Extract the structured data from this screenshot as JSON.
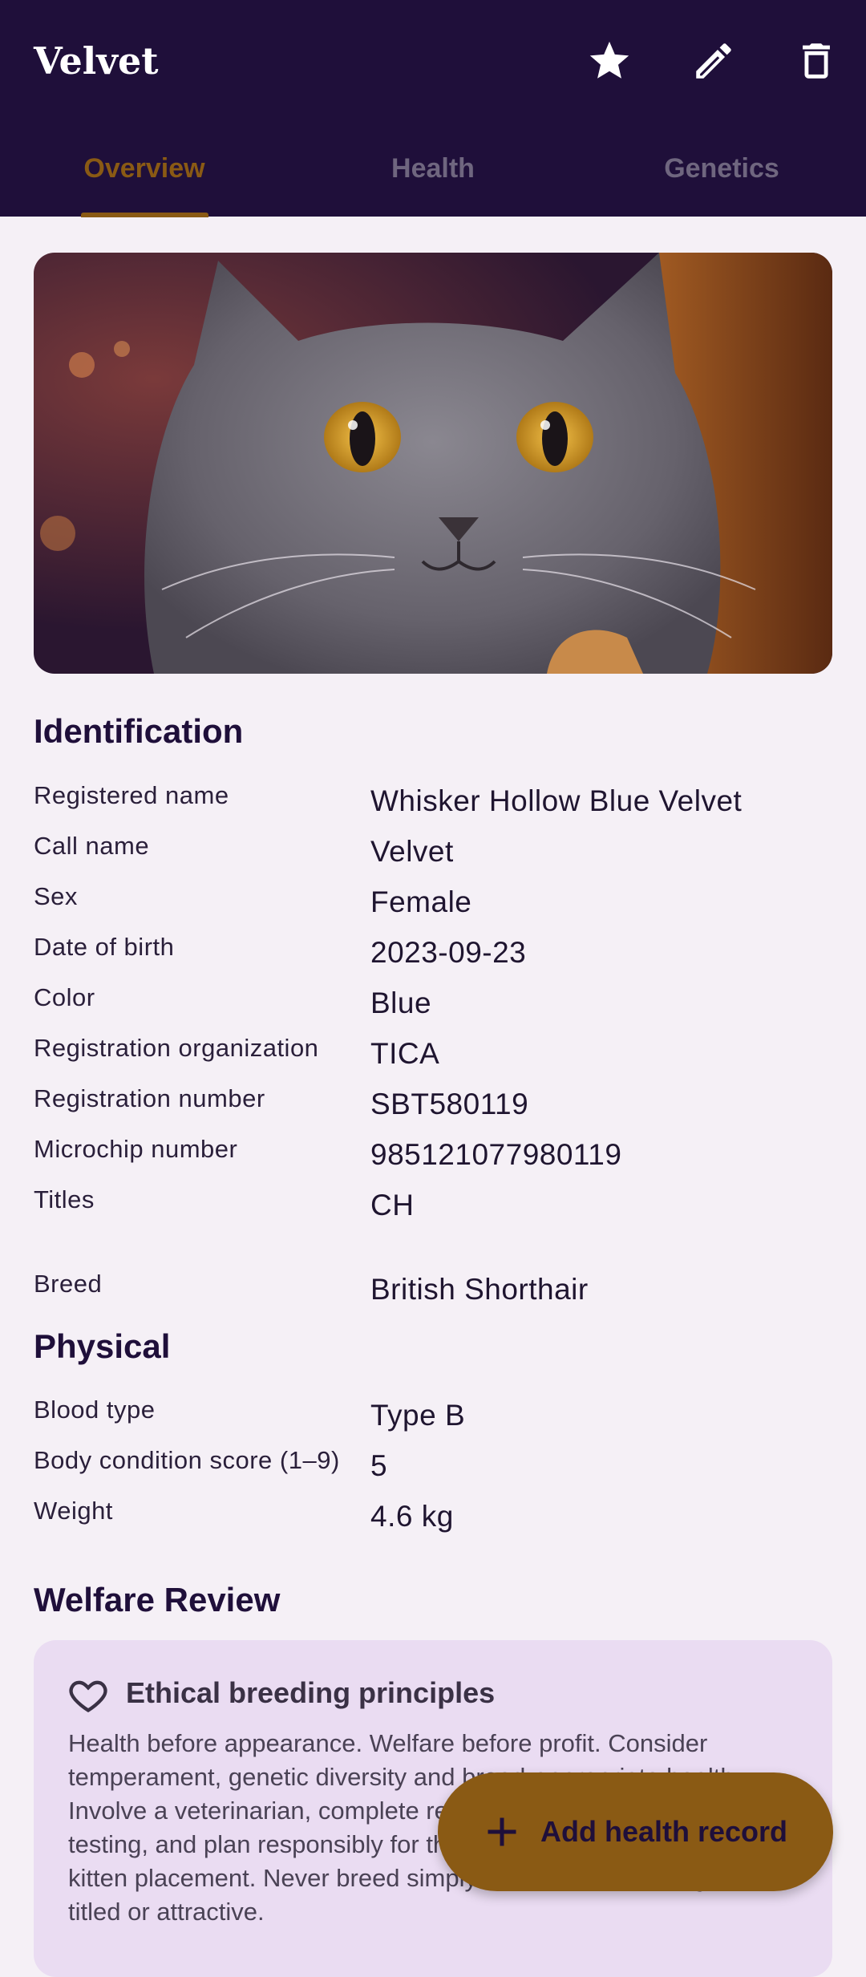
{
  "header": {
    "title": "Velvet",
    "actions": [
      "star-icon",
      "edit-icon",
      "delete-icon"
    ],
    "tabs": [
      {
        "label": "Overview",
        "active": true
      },
      {
        "label": "Health",
        "active": false
      },
      {
        "label": "Genetics",
        "active": false
      }
    ]
  },
  "identification": {
    "title": "Identification",
    "rows": [
      {
        "label": "Registered name",
        "value": "Whisker Hollow Blue Velvet"
      },
      {
        "label": "Call name",
        "value": "Velvet"
      },
      {
        "label": "Sex",
        "value": "Female"
      },
      {
        "label": "Date of birth",
        "value": "2023-09-23"
      },
      {
        "label": "Color",
        "value": "Blue"
      },
      {
        "label": "Registration organization",
        "value": "TICA"
      },
      {
        "label": "Registration number",
        "value": "SBT580119"
      },
      {
        "label": "Microchip number",
        "value": "985121077980119"
      },
      {
        "label": "Titles",
        "value": "CH"
      },
      {
        "label": "Breed",
        "value": "British Shorthair"
      }
    ]
  },
  "physical": {
    "title": "Physical",
    "rows": [
      {
        "label": "Blood type",
        "value": "Type B"
      },
      {
        "label": "Body condition score (1–9)",
        "value": "5"
      },
      {
        "label": "Weight",
        "value": "4.6 kg"
      }
    ]
  },
  "welfare": {
    "title": "Welfare Review",
    "card_title": "Ethical breeding principles",
    "card_body": "Health before appearance. Welfare before profit. Consider temperament, genetic diversity and breed-appropriate health. Involve a veterinarian, complete relevant health and genetic testing, and plan responsibly for the queen, take responsibility and kitten placement. Never breed simply because a cat is registered, titled or attractive."
  },
  "fab": {
    "label": "Add health record",
    "icon": "plus-icon"
  },
  "colors": {
    "appbar": "#1f0f3a",
    "accent": "#8a5a14",
    "background": "#f5f0f6",
    "card": "#eadcf2"
  }
}
